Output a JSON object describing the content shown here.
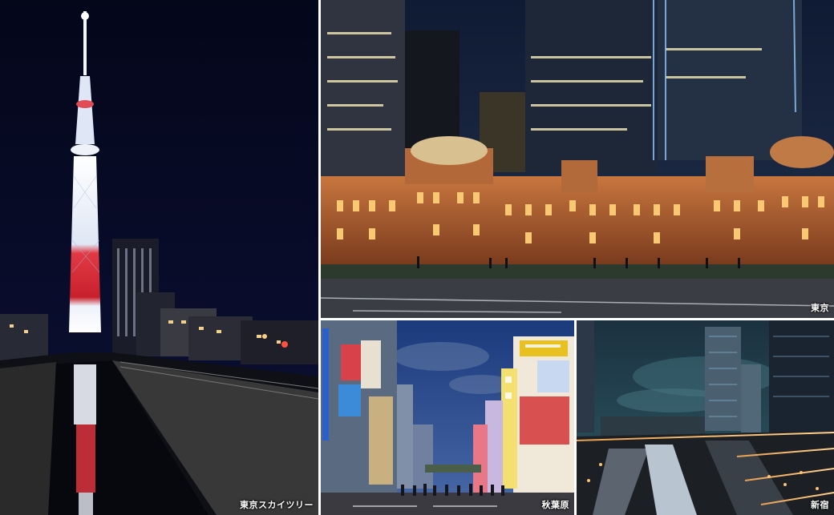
{
  "photos": [
    {
      "id": "skytree",
      "caption": "東京スカイツリー"
    },
    {
      "id": "tokyo-station",
      "caption": "東京"
    },
    {
      "id": "akihabara",
      "caption": "秋葉原"
    },
    {
      "id": "shinjuku",
      "caption": "新宿"
    }
  ],
  "colors": {
    "night_sky": "#05081a",
    "tower_light": "#e8eef8",
    "tower_red": "#d8303a",
    "station_brick": "#a0522d",
    "station_glow": "#f6b04a",
    "akihabara_sky": "#1b3a78",
    "shinjuku_sky": "#1d3f4e"
  }
}
